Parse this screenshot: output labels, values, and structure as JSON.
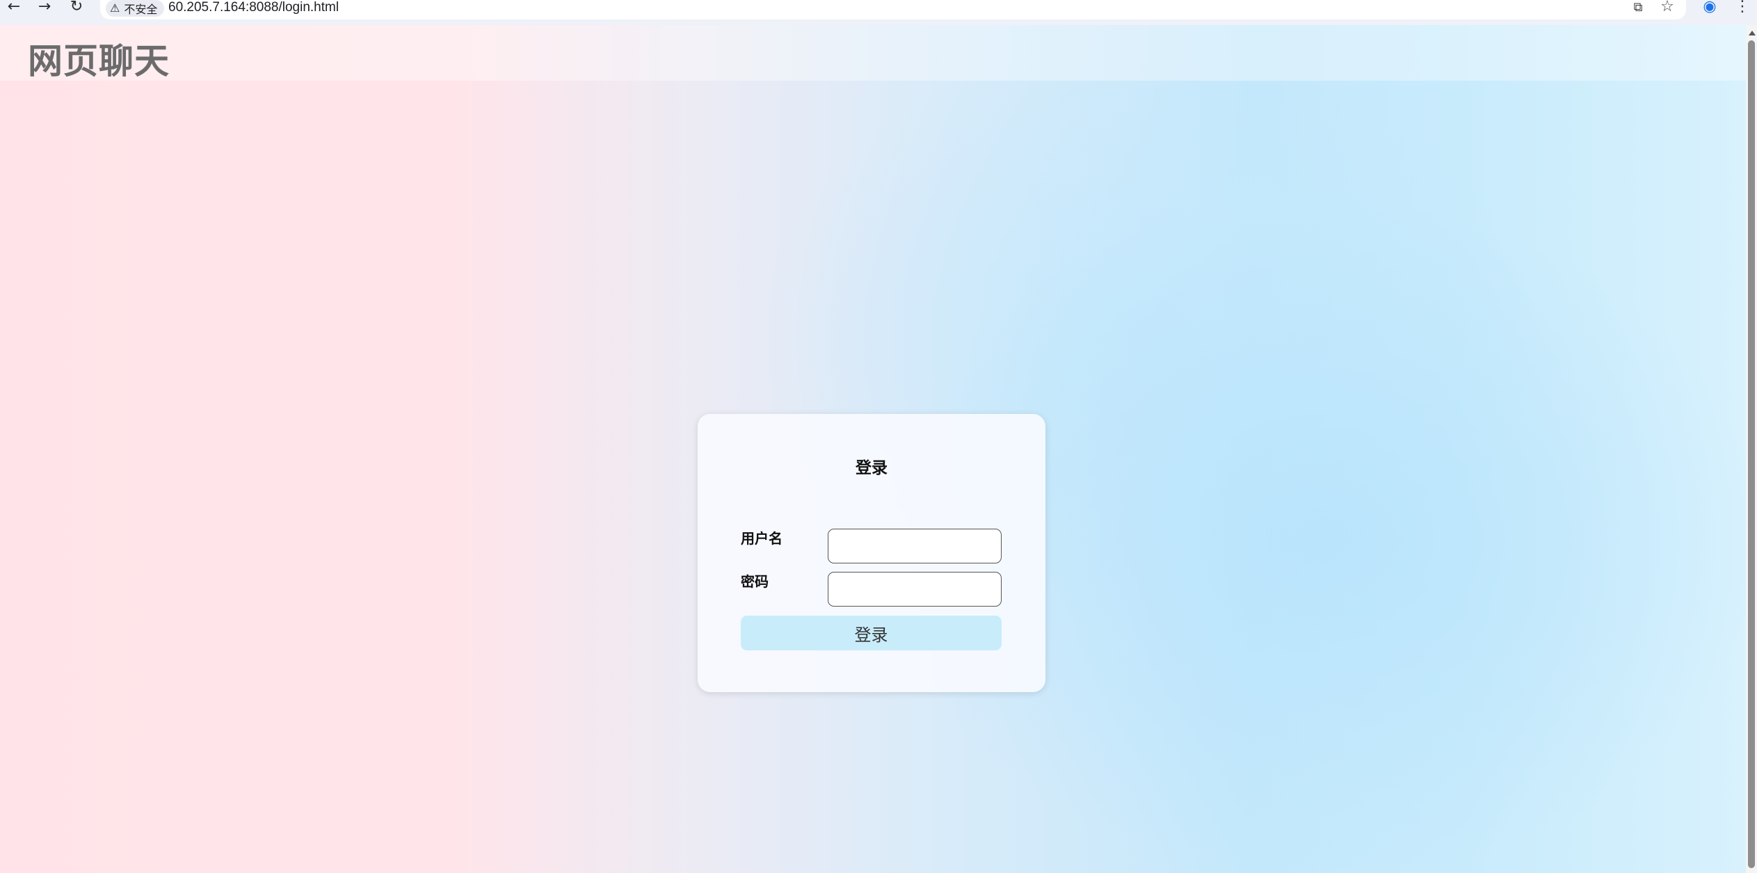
{
  "browser": {
    "back_icon": "arrow-left-icon",
    "forward_icon": "arrow-right-icon",
    "reload_icon": "reload-icon",
    "security_label": "不安全",
    "url": "60.205.7.164:8088/login.html",
    "translate_icon": "translate-icon",
    "bookmark_icon": "star-icon",
    "profile_icon": "account-icon",
    "menu_icon": "more-vertical-icon"
  },
  "header": {
    "title": "网页聊天"
  },
  "login": {
    "title": "登录",
    "username_label": "用户名",
    "username_value": "",
    "password_label": "密码",
    "password_value": "",
    "submit_label": "登录"
  }
}
